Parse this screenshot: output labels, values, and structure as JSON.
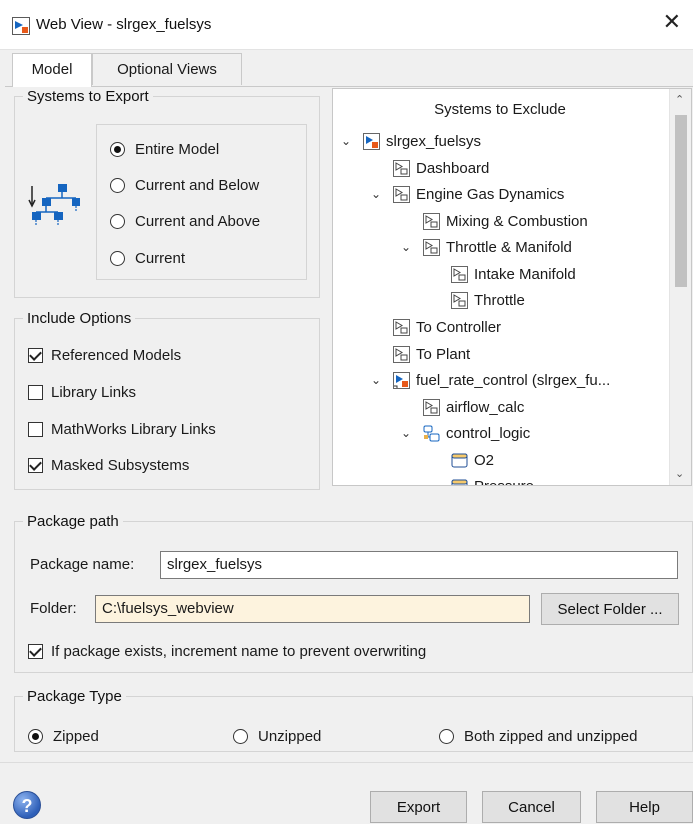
{
  "window": {
    "title": "Web View - slrgex_fuelsys",
    "close_glyph": "✕",
    "icon": "simulink-model-icon"
  },
  "tabs": [
    {
      "label": "Model",
      "active": true
    },
    {
      "label": "Optional Views",
      "active": false
    }
  ],
  "systems_to_export": {
    "legend": "Systems to Export",
    "icon": "hierarchy-icon",
    "options": [
      {
        "label": "Entire Model",
        "selected": true
      },
      {
        "label": "Current and Below",
        "selected": false
      },
      {
        "label": "Current and Above",
        "selected": false
      },
      {
        "label": "Current",
        "selected": false
      }
    ]
  },
  "include_options": {
    "legend": "Include Options",
    "items": [
      {
        "label": "Referenced Models",
        "checked": true
      },
      {
        "label": "Library Links",
        "checked": false
      },
      {
        "label": "MathWorks Library Links",
        "checked": false
      },
      {
        "label": "Masked Subsystems",
        "checked": true
      }
    ]
  },
  "systems_to_exclude": {
    "header": "Systems to Exclude",
    "nodes": [
      {
        "label": "slrgex_fuelsys",
        "icon": "model-icon",
        "expanded": true
      },
      {
        "label": "Dashboard",
        "icon": "subsystem-icon"
      },
      {
        "label": "Engine Gas Dynamics",
        "icon": "subsystem-icon",
        "expanded": true
      },
      {
        "label": "Mixing & Combustion",
        "icon": "subsystem-icon"
      },
      {
        "label": "Throttle & Manifold",
        "icon": "subsystem-icon",
        "expanded": true
      },
      {
        "label": "Intake Manifold",
        "icon": "subsystem-icon"
      },
      {
        "label": "Throttle",
        "icon": "subsystem-icon"
      },
      {
        "label": "To Controller",
        "icon": "subsystem-icon"
      },
      {
        "label": "To Plant",
        "icon": "subsystem-icon"
      },
      {
        "label": "fuel_rate_control (slrgex_fu...",
        "icon": "referenced-model-icon",
        "expanded": true
      },
      {
        "label": "airflow_calc",
        "icon": "subsystem-icon"
      },
      {
        "label": "control_logic",
        "icon": "stateflow-chart-icon",
        "expanded": true
      },
      {
        "label": "O2",
        "icon": "state-icon"
      },
      {
        "label": "Pressure",
        "icon": "state-icon",
        "expanded": true
      }
    ]
  },
  "package_path": {
    "legend": "Package path",
    "name_label": "Package name:",
    "name_value": "slrgex_fuelsys",
    "folder_label": "Folder:",
    "folder_value": "C:\\fuelsys_webview",
    "select_folder_label": "Select Folder ...",
    "increment_label": "If package exists, increment name to prevent overwriting",
    "increment_checked": true
  },
  "package_type": {
    "legend": "Package Type",
    "options": [
      {
        "label": "Zipped",
        "selected": true
      },
      {
        "label": "Unzipped",
        "selected": false
      },
      {
        "label": "Both zipped and unzipped",
        "selected": false
      }
    ]
  },
  "footer": {
    "help_glyph": "?",
    "export_label": "Export",
    "cancel_label": "Cancel",
    "help_label": "Help"
  },
  "colors": {
    "block_blue": "#1565c0",
    "model_orange": "#e8591a",
    "folder_field_bg": "#fdf3de"
  }
}
